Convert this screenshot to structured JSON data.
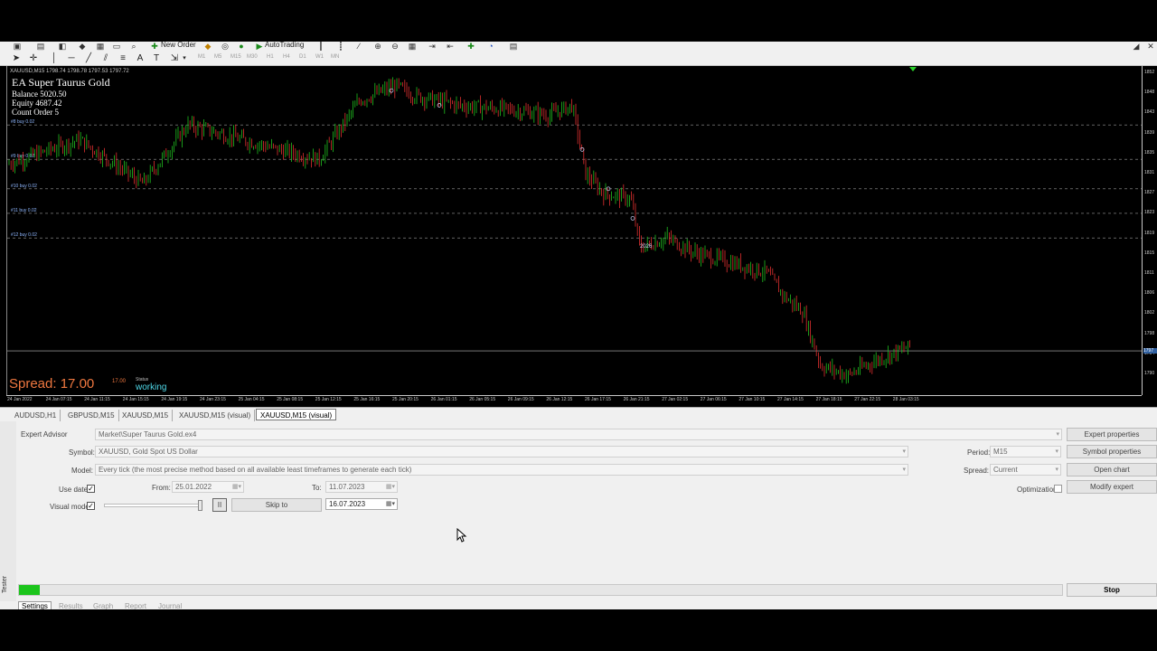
{
  "toolbar": {
    "new_order_label": "New Order",
    "autotrading_label": "AutoTrading",
    "timeframes": [
      "M1",
      "M5",
      "M15",
      "M30",
      "H1",
      "H4",
      "D1",
      "W1",
      "MN"
    ]
  },
  "chart": {
    "symbol_header": "XAUUSD,M15  1798.74 1798.78 1797.53 1797.72",
    "ea_name": "EA Super Taurus Gold",
    "balance_label": "Balance",
    "balance_value": "5020.50",
    "equity_label": "Equity",
    "equity_value": "4687.42",
    "count_label": "Count Order",
    "count_value": "5",
    "spread_label": "Spread:",
    "spread_value": "17.00",
    "spread_small": "17.00",
    "status_label": "Status",
    "status_value": "working",
    "order_lines": [
      "#8 buy 0.02",
      "#9 buy 0.02",
      "#10 buy 0.02",
      "#11 buy 0.02",
      "#12 buy 0.02"
    ],
    "trade_label": "2026",
    "price_ticks": [
      "1852",
      "1848",
      "1843",
      "1839",
      "1835",
      "1831",
      "1827",
      "1823",
      "1819",
      "1815",
      "1811",
      "1806",
      "1802",
      "1798",
      "1794",
      "1790"
    ],
    "current_price": "1797",
    "time_ticks": [
      "24 Jan 2022",
      "24 Jan 07:15",
      "24 Jan 11:15",
      "24 Jan 15:15",
      "24 Jan 19:15",
      "24 Jan 23:15",
      "25 Jan 04:15",
      "25 Jan 08:15",
      "25 Jan 12:15",
      "25 Jan 16:15",
      "25 Jan 20:15",
      "26 Jan 01:15",
      "26 Jan 05:15",
      "26 Jan 09:15",
      "26 Jan 12:15",
      "26 Jan 17:15",
      "26 Jan 21:15",
      "27 Jan 02:15",
      "27 Jan 06:15",
      "27 Jan 10:15",
      "27 Jan 14:15",
      "27 Jan 18:15",
      "27 Jan 22:15",
      "28 Jan 03:15"
    ],
    "colors": {
      "bull": "#20c020",
      "bear": "#e03030",
      "grid": "#9a9a9a",
      "background": "#000000"
    }
  },
  "chart_tabs": [
    "AUDUSD,H1",
    "GBPUSD,M15",
    "XAUUSD,M15",
    "XAUUSD,M15 (visual)",
    "XAUUSD,M15 (visual)"
  ],
  "tester": {
    "expert_advisor_label": "Expert Advisor",
    "expert_advisor_value": "Market\\Super Taurus Gold.ex4",
    "symbol_label": "Symbol:",
    "symbol_value": "XAUUSD, Gold Spot US Dollar",
    "model_label": "Model:",
    "model_value": "Every tick (the most precise method based on all available least timeframes to generate each tick)",
    "use_date_label": "Use date",
    "from_label": "From:",
    "from_value": "25.01.2022",
    "to_label": "To:",
    "to_value": "11.07.2023",
    "visual_mode_label": "Visual mode",
    "pause_label": "II",
    "skip_to_label": "Skip to",
    "skip_date_value": "16.07.2023",
    "period_label": "Period:",
    "period_value": "M15",
    "spread_label": "Spread:",
    "spread_value": "Current",
    "optimization_label": "Optimization",
    "expert_properties_label": "Expert properties",
    "symbol_properties_label": "Symbol properties",
    "open_chart_label": "Open chart",
    "modify_expert_label": "Modify expert",
    "stop_label": "Stop",
    "progress_fraction": 0.02
  },
  "bottom_tabs": [
    "Settings",
    "Results",
    "Graph",
    "Report",
    "Journal"
  ],
  "side_label": "Tester"
}
